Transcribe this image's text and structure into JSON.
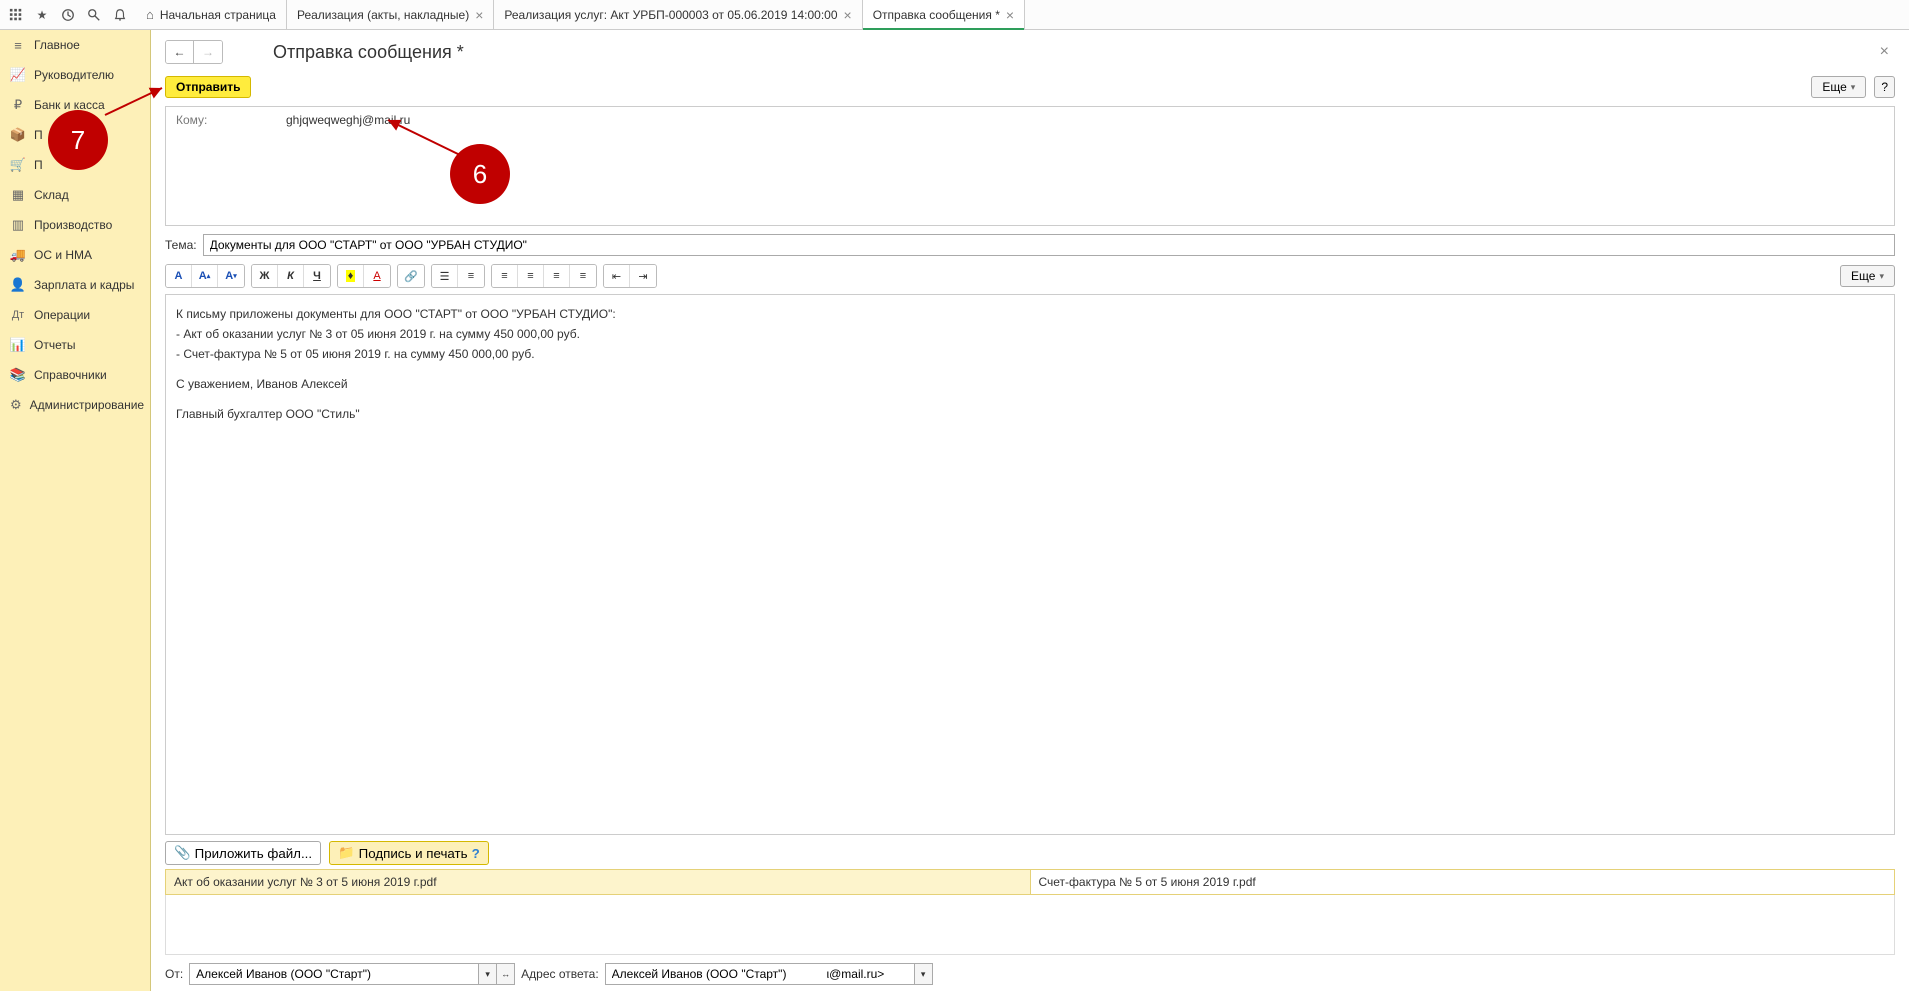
{
  "tabs": [
    {
      "label": "Начальная страница",
      "closable": false,
      "active": false
    },
    {
      "label": "Реализация (акты, накладные)",
      "closable": true,
      "active": false
    },
    {
      "label": "Реализация услуг: Акт УРБП-000003 от 05.06.2019 14:00:00",
      "closable": true,
      "active": false
    },
    {
      "label": "Отправка сообщения *",
      "closable": true,
      "active": true
    }
  ],
  "sidebar": {
    "items": [
      {
        "label": "Главное",
        "icon": "menu"
      },
      {
        "label": "Руководителю",
        "icon": "chart-up"
      },
      {
        "label": "Банк и касса",
        "icon": "ruble"
      },
      {
        "label": "П",
        "icon": "box"
      },
      {
        "label": "П",
        "icon": "cart"
      },
      {
        "label": "Склад",
        "icon": "grid"
      },
      {
        "label": "Производство",
        "icon": "bars"
      },
      {
        "label": "ОС и НМА",
        "icon": "truck"
      },
      {
        "label": "Зарплата и кадры",
        "icon": "person"
      },
      {
        "label": "Операции",
        "icon": "ops"
      },
      {
        "label": "Отчеты",
        "icon": "report"
      },
      {
        "label": "Справочники",
        "icon": "book"
      },
      {
        "label": "Администрирование",
        "icon": "gear"
      }
    ]
  },
  "page": {
    "title": "Отправка сообщения *",
    "send_button": "Отправить",
    "more_button": "Еще",
    "help_button": "?",
    "to_label": "Кому:",
    "to_value": "ghjqweqweghj@mail.ru",
    "subject_label": "Тема:",
    "subject_value": "Документы для ООО \"СТАРТ\" от ООО \"УРБАН СТУДИО\"",
    "body": {
      "line1": "К письму приложены документы для ООО \"СТАРТ\" от ООО \"УРБАН СТУДИО\":",
      "line2": "- Акт об оказании услуг № 3 от 05 июня 2019 г. на сумму 450 000,00 руб.",
      "line3": "- Счет-фактура № 5 от 05 июня 2019 г. на сумму 450 000,00 руб.",
      "line4": "С уважением, Иванов Алексей",
      "line5": "Главный бухгалтер ООО \"Стиль\""
    },
    "editor_more": "Еще",
    "attach_button": "Приложить файл...",
    "sign_button": "Подпись и печать",
    "attachments": [
      "Акт об оказании услуг № 3 от 5 июня 2019 г.pdf",
      "Счет-фактура № 5 от 5 июня 2019 г.pdf"
    ],
    "from_label": "От:",
    "from_value": "Алексей Иванов (ООО \"Старт\")",
    "reply_label": "Адрес ответа:",
    "reply_value": "Алексей Иванов (ООО \"Старт\")            ι@mail.ru>"
  },
  "annotations": {
    "six": "6",
    "seven": "7"
  }
}
